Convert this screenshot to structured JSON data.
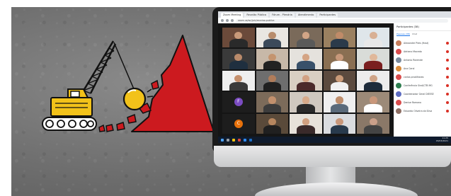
{
  "browser": {
    "tabs": [
      {
        "label": "Zoom Meeting"
      },
      {
        "label": "Reunião Pública"
      },
      {
        "label": "Fórum - Plenária"
      },
      {
        "label": "Atendimento"
      },
      {
        "label": "Participantes"
      }
    ],
    "url": "zoom.us/wc/join/reuniao-publica"
  },
  "meeting": {
    "participants_panel_title": "Participantes (38)",
    "panel_tabs": [
      "Pessoas (38)",
      "Chat"
    ],
    "tile_initials": [
      "F",
      "C"
    ],
    "participants": [
      {
        "name": "Alexandre Pires (Host)",
        "color": "#c77d5b"
      },
      {
        "name": "Adriano Macedo",
        "color": "#d94c4c"
      },
      {
        "name": "Antonio Rezende",
        "color": "#7a8a9c"
      },
      {
        "name": "Ana Carol",
        "color": "#d98b3a"
      },
      {
        "name": "carlos pradilhares",
        "color": "#d94c4c"
      },
      {
        "name": "Conferência Sind/CTB MG",
        "color": "#2e7d4f"
      },
      {
        "name": "Coordenador Geral DIEESE",
        "color": "#5c6bc0"
      },
      {
        "name": "Denise Romano",
        "color": "#d94c4c"
      },
      {
        "name": "Eduardo Oliveira da Silva",
        "color": "#8d6e63"
      }
    ]
  },
  "taskbar": {
    "time": "11:25",
    "date": "03/03/2021"
  },
  "colors": {
    "accent_red": "#cc1a1f",
    "crane_yellow": "#f2c21a",
    "ink": "#111111"
  },
  "icons": {
    "crane": "crane-icon",
    "wrecking_ball": "wrecking-ball-icon",
    "mountain": "red-pyramid-icon"
  }
}
